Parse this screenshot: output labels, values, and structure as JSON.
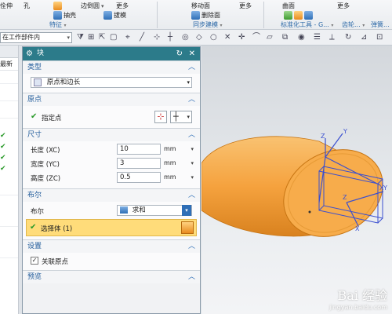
{
  "ribbon": {
    "top_row": [
      "佺伸",
      "孔",
      "边倒圆",
      "更多",
      "移动面",
      "更多",
      "曲面",
      "更多"
    ],
    "items": [
      "抽壳",
      "拔模",
      "删除面"
    ],
    "groups": [
      "特征",
      "同步建模",
      "标准化工具 - G...",
      "齿轮...",
      "弹簧..."
    ]
  },
  "selection_toolbar": {
    "filter_value": "在工作部件内"
  },
  "navigator": {
    "header": "",
    "latest_label": "最新"
  },
  "dialog": {
    "title": "块",
    "type": {
      "header": "类型",
      "value": "原点和边长"
    },
    "origin": {
      "header": "原点",
      "specify_point": "指定点"
    },
    "dimensions": {
      "header": "尺寸",
      "length_label": "长度 (XC)",
      "length_value": "10",
      "length_unit": "mm",
      "width_label": "宽度 (YC)",
      "width_value": "3",
      "width_unit": "mm",
      "height_label": "高度 (ZC)",
      "height_value": "0.5",
      "height_unit": "mm"
    },
    "boolean": {
      "header": "布尔",
      "label": "布尔",
      "value": "求和",
      "select_body": "选择体 (1)"
    },
    "settings": {
      "header": "设置",
      "associative_origin": "关联原点",
      "associative_checked": true
    },
    "preview": {
      "header": "预览"
    }
  },
  "viewport": {
    "axis_labels": [
      "Z",
      "Y",
      "X",
      "Z",
      "Y",
      "X"
    ],
    "watermark_big": "Bai 经验",
    "watermark_small": "jingyan.baidu.com"
  },
  "colors": {
    "dialog_title": "#2c7b8a",
    "section_header": "#1f5a9a",
    "solid_body": "#f6a94a",
    "selected_highlight": "#ffdc7a"
  }
}
